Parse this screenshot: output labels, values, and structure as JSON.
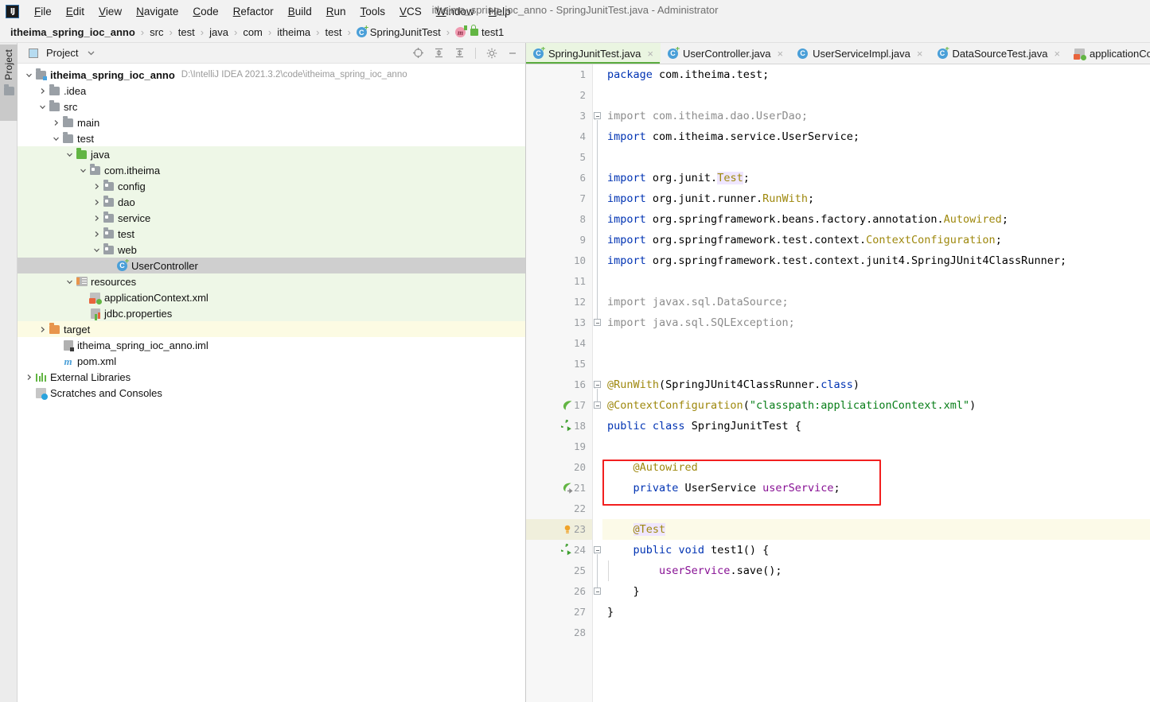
{
  "window": {
    "title": "itheima_spring_ioc_anno - SpringJunitTest.java - Administrator",
    "logo_text": "IJ"
  },
  "menubar": {
    "items": [
      {
        "label": "File",
        "mnemonic": "F"
      },
      {
        "label": "Edit",
        "mnemonic": "E"
      },
      {
        "label": "View",
        "mnemonic": "V"
      },
      {
        "label": "Navigate",
        "mnemonic": "N"
      },
      {
        "label": "Code",
        "mnemonic": "C"
      },
      {
        "label": "Refactor",
        "mnemonic": "R"
      },
      {
        "label": "Build",
        "mnemonic": "B"
      },
      {
        "label": "Run",
        "mnemonic": "R"
      },
      {
        "label": "Tools",
        "mnemonic": "T"
      },
      {
        "label": "VCS",
        "mnemonic": "V"
      },
      {
        "label": "Window",
        "mnemonic": "W"
      },
      {
        "label": "Help",
        "mnemonic": "H"
      }
    ]
  },
  "breadcrumb": {
    "items": [
      {
        "label": "itheima_spring_ioc_anno",
        "bold": true,
        "icon": null
      },
      {
        "label": "src",
        "bold": false,
        "icon": null
      },
      {
        "label": "test",
        "bold": false,
        "icon": null
      },
      {
        "label": "java",
        "bold": false,
        "icon": null
      },
      {
        "label": "com",
        "bold": false,
        "icon": null
      },
      {
        "label": "itheima",
        "bold": false,
        "icon": null
      },
      {
        "label": "test",
        "bold": false,
        "icon": null
      },
      {
        "label": "SpringJunitTest",
        "bold": false,
        "icon": "class-icon"
      },
      {
        "label": "test1",
        "bold": false,
        "icon": "method-icon"
      }
    ],
    "separator": "›"
  },
  "tool_stripe": {
    "project_tab_label": "Project",
    "project_tab_icon": "folder-icon"
  },
  "project_panel": {
    "title": "Project",
    "dropdown_icon": "chevron-down-icon",
    "toolbar_icons": [
      "scroll-from-source-icon",
      "expand-all-icon",
      "collapse-all-icon",
      "settings-gear-icon",
      "hide-panel-icon"
    ],
    "tree": [
      {
        "label": "itheima_spring_ioc_anno",
        "path": "D:\\IntelliJ IDEA 2021.3.2\\code\\itheima_spring_ioc_anno",
        "depth": 0,
        "arrow": "down",
        "icon": "module-icon",
        "bold": true,
        "state": "normal"
      },
      {
        "label": ".idea",
        "depth": 1,
        "arrow": "right",
        "icon": "folder-icon",
        "state": "normal"
      },
      {
        "label": "src",
        "depth": 1,
        "arrow": "down",
        "icon": "folder-icon",
        "state": "normal"
      },
      {
        "label": "main",
        "depth": 2,
        "arrow": "right",
        "icon": "folder-icon",
        "state": "normal"
      },
      {
        "label": "test",
        "depth": 2,
        "arrow": "down",
        "icon": "folder-icon",
        "state": "normal"
      },
      {
        "label": "java",
        "depth": 3,
        "arrow": "down",
        "icon": "test-source-folder-icon",
        "state": "source"
      },
      {
        "label": "com.itheima",
        "depth": 4,
        "arrow": "down",
        "icon": "package-icon",
        "state": "source"
      },
      {
        "label": "config",
        "depth": 5,
        "arrow": "right",
        "icon": "package-icon",
        "state": "source"
      },
      {
        "label": "dao",
        "depth": 5,
        "arrow": "right",
        "icon": "package-icon",
        "state": "source"
      },
      {
        "label": "service",
        "depth": 5,
        "arrow": "right",
        "icon": "package-icon",
        "state": "source"
      },
      {
        "label": "test",
        "depth": 5,
        "arrow": "right",
        "icon": "package-icon",
        "state": "source"
      },
      {
        "label": "web",
        "depth": 5,
        "arrow": "down",
        "icon": "package-icon",
        "state": "source"
      },
      {
        "label": "UserController",
        "depth": 6,
        "arrow": "none",
        "icon": "class-icon",
        "state": "selected"
      },
      {
        "label": "resources",
        "depth": 3,
        "arrow": "down",
        "icon": "resources-folder-icon",
        "state": "source"
      },
      {
        "label": "applicationContext.xml",
        "depth": 4,
        "arrow": "none",
        "icon": "spring-xml-icon",
        "state": "source"
      },
      {
        "label": "jdbc.properties",
        "depth": 4,
        "arrow": "none",
        "icon": "properties-icon",
        "state": "source"
      },
      {
        "label": "target",
        "depth": 1,
        "arrow": "right",
        "icon": "excluded-folder-icon",
        "state": "excluded"
      },
      {
        "label": "itheima_spring_ioc_anno.iml",
        "depth": 2,
        "arrow": "none",
        "icon": "iml-icon",
        "state": "normal"
      },
      {
        "label": "pom.xml",
        "depth": 2,
        "arrow": "none",
        "icon": "maven-icon",
        "state": "normal"
      },
      {
        "label": "External Libraries",
        "depth": 0,
        "arrow": "right",
        "icon": "libraries-icon",
        "state": "normal"
      },
      {
        "label": "Scratches and Consoles",
        "depth": 0,
        "arrow": "none",
        "icon": "scratches-icon",
        "state": "normal"
      }
    ]
  },
  "editor": {
    "tabs": [
      {
        "label": "SpringJunitTest.java",
        "icon": "java-test-class-icon",
        "active": true,
        "close": "×"
      },
      {
        "label": "UserController.java",
        "icon": "java-test-class-icon",
        "active": false,
        "close": "×"
      },
      {
        "label": "UserServiceImpl.java",
        "icon": "java-class-icon",
        "active": false,
        "close": "×"
      },
      {
        "label": "DataSourceTest.java",
        "icon": "java-test-class-icon",
        "active": false,
        "close": "×"
      },
      {
        "label": "applicationCont",
        "icon": "spring-xml-icon",
        "active": false,
        "close": ""
      }
    ],
    "caret_line": 23,
    "annotation_box_color": "#f21f1f",
    "lines": [
      {
        "n": 1,
        "tokens": [
          {
            "t": "package",
            "c": "kw"
          },
          {
            "t": " com.itheima.test;",
            "c": ""
          }
        ]
      },
      {
        "n": 2,
        "tokens": []
      },
      {
        "n": 3,
        "tokens": [
          {
            "t": "import com.itheima.dao.UserDao;",
            "c": "dim"
          }
        ]
      },
      {
        "n": 4,
        "tokens": [
          {
            "t": "import",
            "c": "kw"
          },
          {
            "t": " com.itheima.service.UserService;",
            "c": ""
          }
        ]
      },
      {
        "n": 5,
        "tokens": []
      },
      {
        "n": 6,
        "tokens": [
          {
            "t": "import",
            "c": "kw"
          },
          {
            "t": " org.junit.",
            "c": ""
          },
          {
            "t": "Test",
            "c": "ann hl"
          },
          {
            "t": ";",
            "c": ""
          }
        ]
      },
      {
        "n": 7,
        "tokens": [
          {
            "t": "import",
            "c": "kw"
          },
          {
            "t": " org.junit.runner.",
            "c": ""
          },
          {
            "t": "RunWith",
            "c": "ann"
          },
          {
            "t": ";",
            "c": ""
          }
        ]
      },
      {
        "n": 8,
        "tokens": [
          {
            "t": "import",
            "c": "kw"
          },
          {
            "t": " org.springframework.beans.factory.annotation.",
            "c": ""
          },
          {
            "t": "Autowired",
            "c": "ann"
          },
          {
            "t": ";",
            "c": ""
          }
        ]
      },
      {
        "n": 9,
        "tokens": [
          {
            "t": "import",
            "c": "kw"
          },
          {
            "t": " org.springframework.test.context.",
            "c": ""
          },
          {
            "t": "ContextConfiguration",
            "c": "ann"
          },
          {
            "t": ";",
            "c": ""
          }
        ]
      },
      {
        "n": 10,
        "tokens": [
          {
            "t": "import",
            "c": "kw"
          },
          {
            "t": " org.springframework.test.context.junit4.SpringJUnit4ClassRunner;",
            "c": ""
          }
        ]
      },
      {
        "n": 11,
        "tokens": []
      },
      {
        "n": 12,
        "tokens": [
          {
            "t": "import javax.sql.DataSource;",
            "c": "dim"
          }
        ]
      },
      {
        "n": 13,
        "tokens": [
          {
            "t": "import java.sql.SQLException;",
            "c": "dim"
          }
        ]
      },
      {
        "n": 14,
        "tokens": []
      },
      {
        "n": 15,
        "tokens": []
      },
      {
        "n": 16,
        "tokens": [
          {
            "t": "@RunWith",
            "c": "ann"
          },
          {
            "t": "(SpringJUnit4ClassRunner.",
            "c": ""
          },
          {
            "t": "class",
            "c": "kw"
          },
          {
            "t": ")",
            "c": ""
          }
        ]
      },
      {
        "n": 17,
        "tokens": [
          {
            "t": "@ContextConfiguration",
            "c": "ann"
          },
          {
            "t": "(",
            "c": ""
          },
          {
            "t": "\"classpath:applicationContext.xml\"",
            "c": "str"
          },
          {
            "t": ")",
            "c": ""
          }
        ],
        "gutter_icon": "spring-bean-icon"
      },
      {
        "n": 18,
        "tokens": [
          {
            "t": "public",
            "c": "kw"
          },
          {
            "t": " ",
            "c": ""
          },
          {
            "t": "class",
            "c": "kw"
          },
          {
            "t": " SpringJunitTest {",
            "c": ""
          }
        ],
        "gutter_icon": "run-test-icon"
      },
      {
        "n": 19,
        "tokens": []
      },
      {
        "n": 20,
        "tokens": [
          {
            "t": "    @Autowired",
            "c": "ann"
          }
        ]
      },
      {
        "n": 21,
        "tokens": [
          {
            "t": "    ",
            "c": ""
          },
          {
            "t": "private",
            "c": "kw"
          },
          {
            "t": " UserService ",
            "c": ""
          },
          {
            "t": "userService",
            "c": "fld"
          },
          {
            "t": ";",
            "c": ""
          }
        ],
        "gutter_icon": "navigate-bean-icon"
      },
      {
        "n": 22,
        "tokens": []
      },
      {
        "n": 23,
        "tokens": [
          {
            "t": "    ",
            "c": ""
          },
          {
            "t": "@Test",
            "c": "ann hl"
          }
        ],
        "gutter_icon": "intention-bulb-icon"
      },
      {
        "n": 24,
        "tokens": [
          {
            "t": "    ",
            "c": ""
          },
          {
            "t": "public",
            "c": "kw"
          },
          {
            "t": " ",
            "c": ""
          },
          {
            "t": "void",
            "c": "kw"
          },
          {
            "t": " test1() {",
            "c": ""
          }
        ],
        "gutter_icon": "run-test-icon"
      },
      {
        "n": 25,
        "tokens": [
          {
            "t": "        ",
            "c": ""
          },
          {
            "t": "userService",
            "c": "fld"
          },
          {
            "t": ".save();",
            "c": ""
          }
        ]
      },
      {
        "n": 26,
        "tokens": [
          {
            "t": "    }",
            "c": ""
          }
        ]
      },
      {
        "n": 27,
        "tokens": [
          {
            "t": "}",
            "c": ""
          }
        ]
      },
      {
        "n": 28,
        "tokens": []
      }
    ]
  },
  "colors": {
    "accent_green": "#62b543",
    "annotation_red": "#f21f1f",
    "keyword_blue": "#0033b3",
    "annotation_gold": "#9e880d",
    "string_green": "#067d17",
    "field_purple": "#871094",
    "selection_gray": "#cfcfcf",
    "source_root_green": "#eef7e7"
  }
}
